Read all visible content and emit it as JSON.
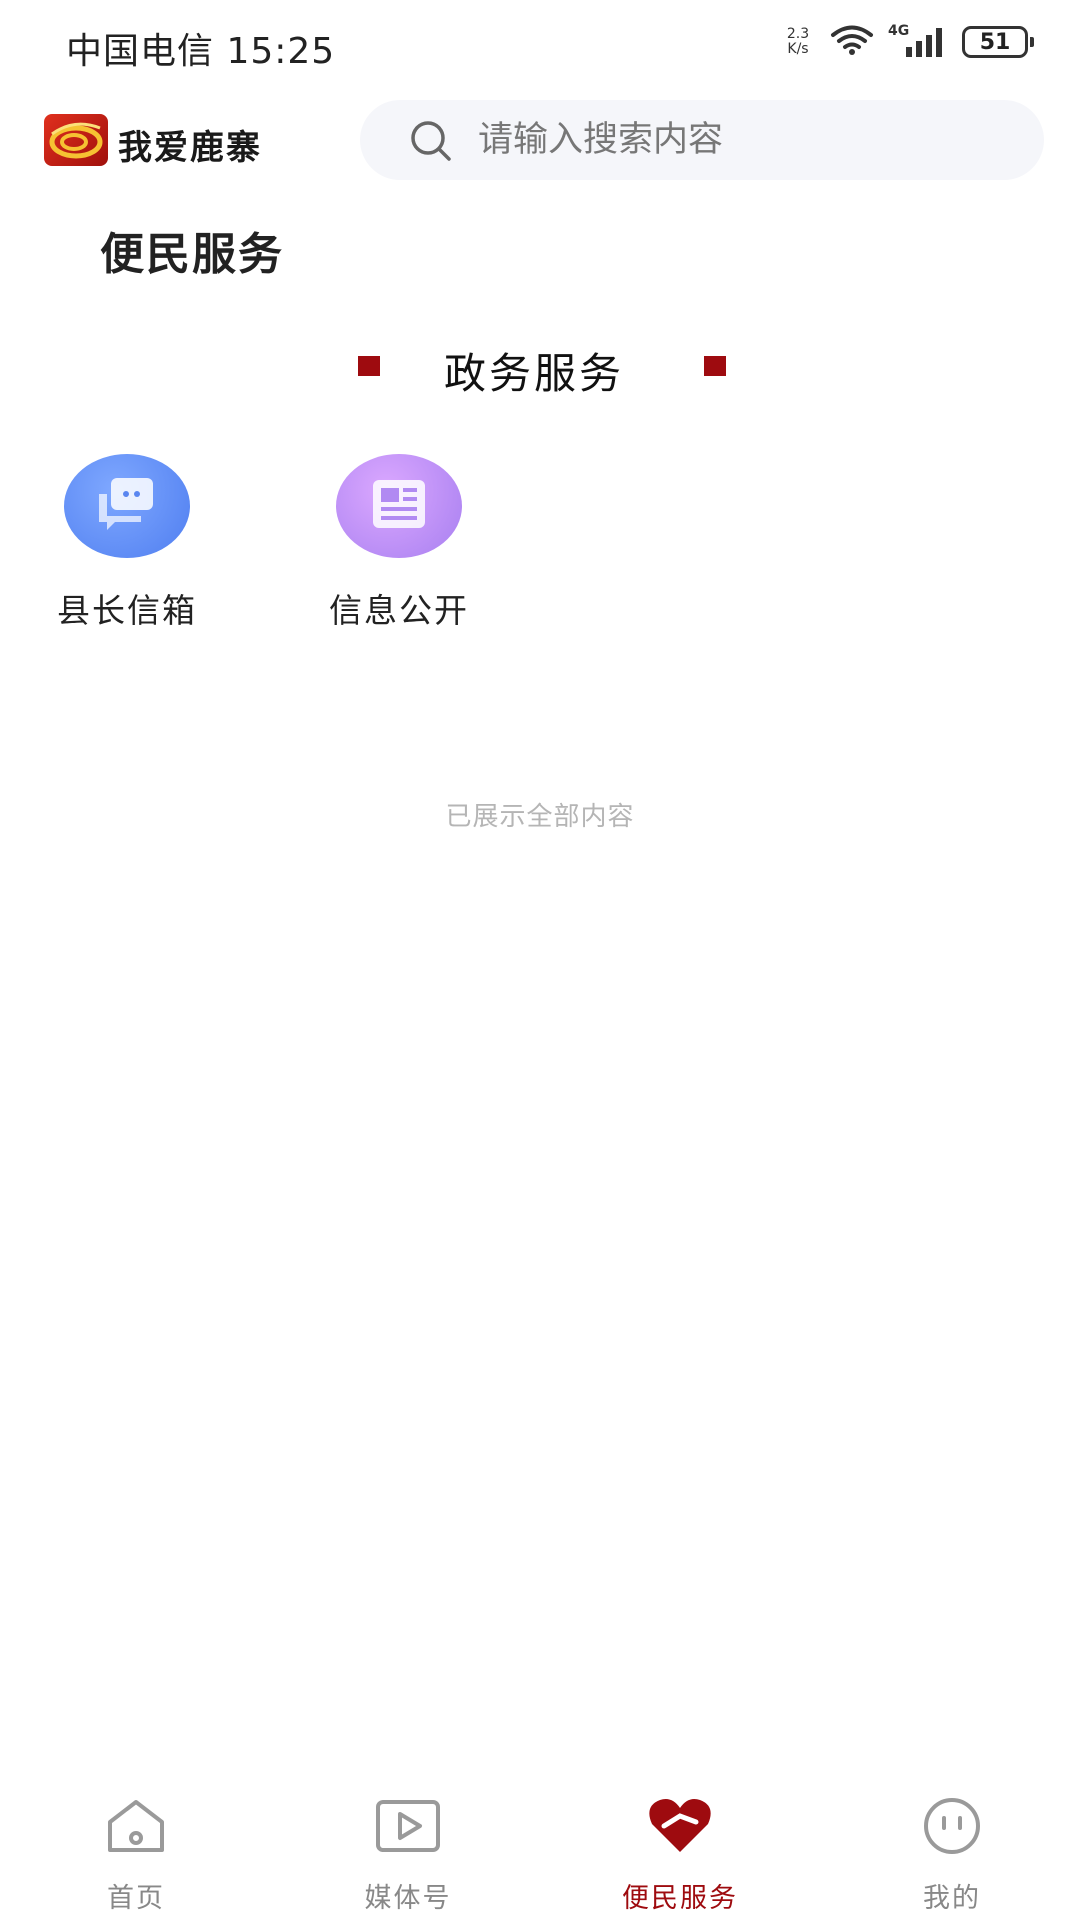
{
  "status_bar": {
    "carrier_time": "中国电信 15:25",
    "net_speed_value": "2.3",
    "net_speed_unit": "K/s",
    "network_type": "4G",
    "battery": "51"
  },
  "header": {
    "brand": "我爱鹿寨",
    "search_placeholder": "请输入搜索内容"
  },
  "page_title": "便民服务",
  "section": {
    "title": "政务服务",
    "items": [
      {
        "label": "县长信箱",
        "icon": "chat-bubbles-icon"
      },
      {
        "label": "信息公开",
        "icon": "news-document-icon"
      }
    ]
  },
  "end_hint": "已展示全部内容",
  "bottom_nav": {
    "items": [
      {
        "label": "首页",
        "icon": "home-icon",
        "active": false
      },
      {
        "label": "媒体号",
        "icon": "play-icon",
        "active": false
      },
      {
        "label": "便民服务",
        "icon": "heart-icon",
        "active": true
      },
      {
        "label": "我的",
        "icon": "face-icon",
        "active": false
      }
    ]
  },
  "colors": {
    "accent": "#9e0b0f",
    "search_bg": "#f5f6fa",
    "inactive_nav": "#888888"
  }
}
